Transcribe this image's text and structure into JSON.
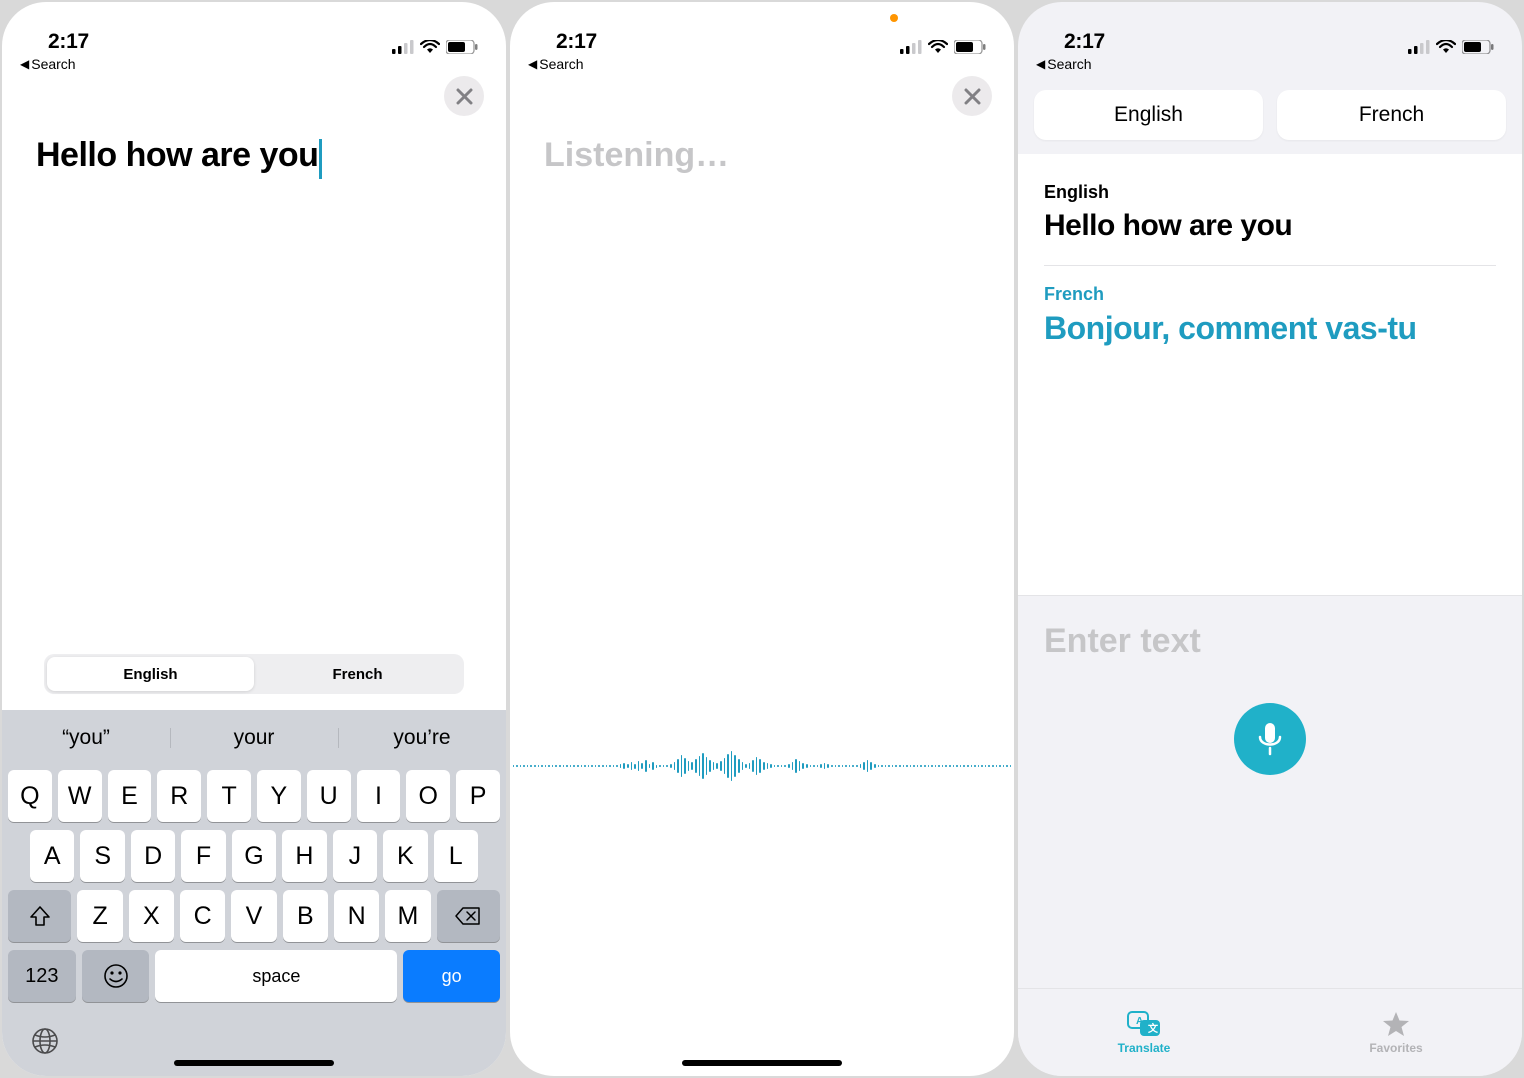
{
  "status": {
    "time": "2:17",
    "back": "Search"
  },
  "screen1": {
    "typed": "Hello how are you",
    "segmented": {
      "left": "English",
      "right": "French"
    },
    "suggestions": [
      "“you”",
      "your",
      "you’re"
    ],
    "rows": {
      "r1": [
        "Q",
        "W",
        "E",
        "R",
        "T",
        "Y",
        "U",
        "I",
        "O",
        "P"
      ],
      "r2": [
        "A",
        "S",
        "D",
        "F",
        "G",
        "H",
        "J",
        "K",
        "L"
      ],
      "r3": [
        "Z",
        "X",
        "C",
        "V",
        "B",
        "N",
        "M"
      ]
    },
    "numKey": "123",
    "space": "space",
    "go": "go"
  },
  "screen2": {
    "listening": "Listening…"
  },
  "screen3": {
    "pills": {
      "left": "English",
      "right": "French"
    },
    "srcLabel": "English",
    "srcText": "Hello how are you",
    "tgtLabel": "French",
    "tgtText": "Bonjour, comment vas-tu",
    "enterText": "Enter text",
    "tabs": {
      "translate": "Translate",
      "favorites": "Favorites"
    }
  }
}
